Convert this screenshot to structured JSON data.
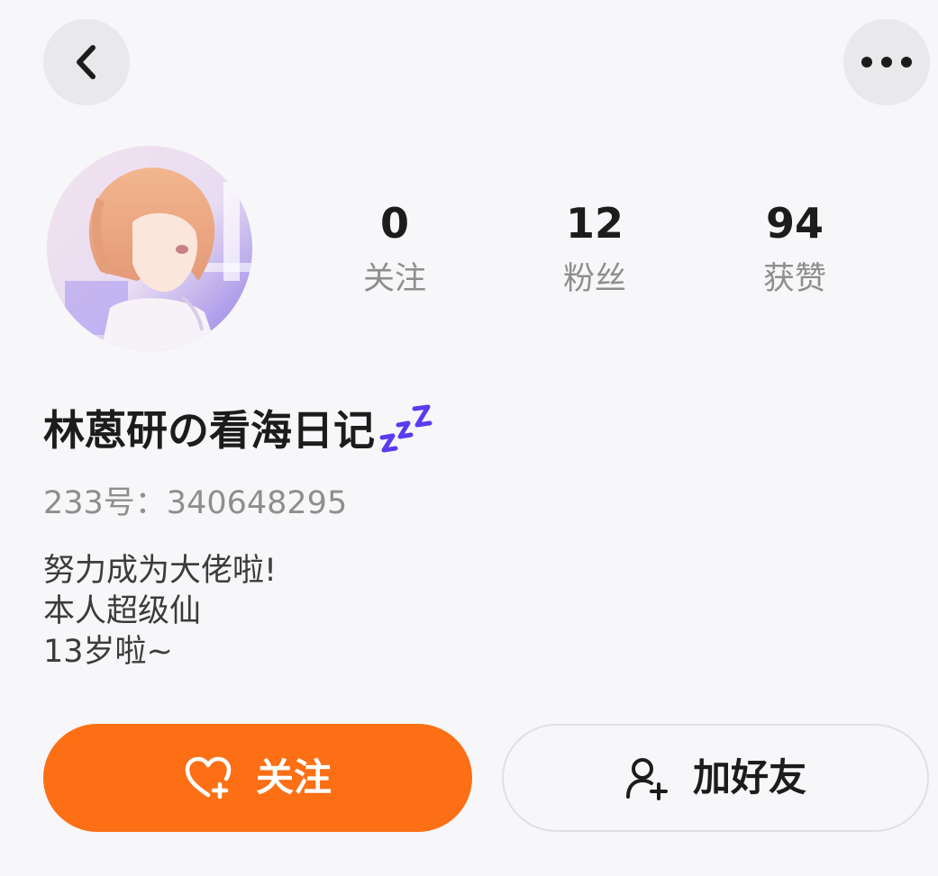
{
  "header": {
    "back_icon": "chevron-left-icon",
    "more_icon": "more-horizontal-icon"
  },
  "profile": {
    "avatar": "anime-girl-avatar",
    "stats": [
      {
        "value": "0",
        "label": "关注"
      },
      {
        "value": "12",
        "label": "粉丝"
      },
      {
        "value": "94",
        "label": "获赞"
      }
    ],
    "nickname": "林蒽研の看海日记",
    "nickname_badge_icon": "zzz-sleep-icon",
    "account_id": "233号：340648295",
    "bio": [
      "努力成为大佬啦!",
      "本人超级仙",
      "13岁啦~"
    ]
  },
  "actions": {
    "follow_label": "关注",
    "follow_icon": "heart-plus-icon",
    "add_friend_label": "加好友",
    "add_friend_icon": "user-plus-icon"
  },
  "colors": {
    "accent": "#fc6f15",
    "background": "#f7f7f9",
    "zzz": "#5a3cf0"
  }
}
